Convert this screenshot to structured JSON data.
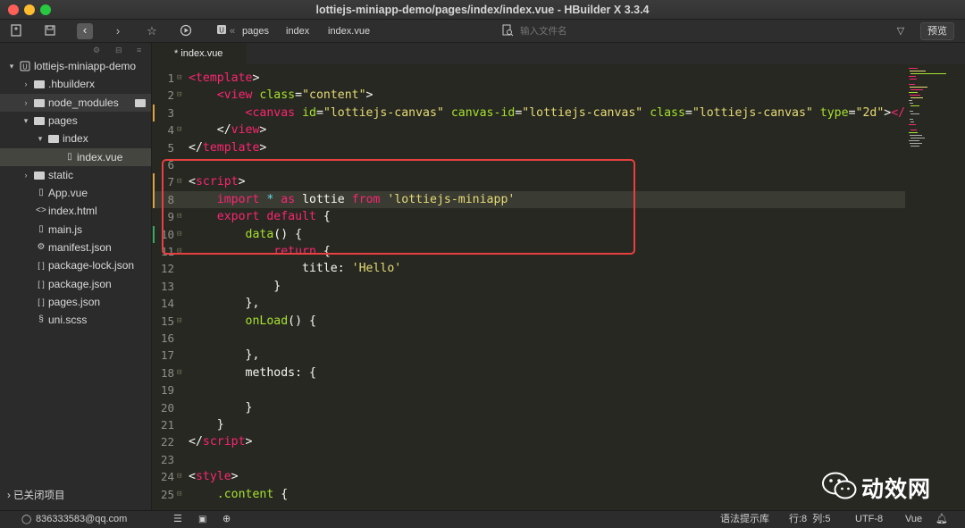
{
  "window": {
    "title": "lottiejs-miniapp-demo/pages/index/index.vue - HBuilder X 3.3.4"
  },
  "toolbar": {
    "breadcrumb": [
      "pages",
      "index",
      "index.vue"
    ],
    "breadcrumb_prefix": "«",
    "search_placeholder": "输入文件名",
    "preview_label": "预览"
  },
  "sidebar": {
    "items": [
      {
        "label": "lottiejs-miniapp-demo",
        "indent": 0,
        "arrow": "▾",
        "icon": "U"
      },
      {
        "label": ".hbuilderx",
        "indent": 1,
        "arrow": "›",
        "icon": "folder"
      },
      {
        "label": "node_modules",
        "indent": 1,
        "arrow": "›",
        "icon": "folder"
      },
      {
        "label": "pages",
        "indent": 1,
        "arrow": "▾",
        "icon": "folder"
      },
      {
        "label": "index",
        "indent": 2,
        "arrow": "▾",
        "icon": "folder"
      },
      {
        "label": "index.vue",
        "indent": 3,
        "arrow": "",
        "icon": "V"
      },
      {
        "label": "static",
        "indent": 1,
        "arrow": "›",
        "icon": "folder"
      },
      {
        "label": "App.vue",
        "indent": 1,
        "arrow": "",
        "icon": "V"
      },
      {
        "label": "index.html",
        "indent": 1,
        "arrow": "",
        "icon": "<>"
      },
      {
        "label": "main.js",
        "indent": 1,
        "arrow": "",
        "icon": "JS"
      },
      {
        "label": "manifest.json",
        "indent": 1,
        "arrow": "",
        "icon": "⚙"
      },
      {
        "label": "package-lock.json",
        "indent": 1,
        "arrow": "",
        "icon": "[ ]"
      },
      {
        "label": "package.json",
        "indent": 1,
        "arrow": "",
        "icon": "[ ]"
      },
      {
        "label": "pages.json",
        "indent": 1,
        "arrow": "",
        "icon": "[ ]"
      },
      {
        "label": "uni.scss",
        "indent": 1,
        "arrow": "",
        "icon": "S"
      }
    ],
    "closed_projects": "已关闭项目"
  },
  "tab": {
    "label": "* index.vue"
  },
  "editor": {
    "lines": [
      {
        "n": "1",
        "fold": "⊟",
        "tokens": [
          [
            "tag",
            "<template"
          ],
          [
            "pl",
            ">"
          ]
        ]
      },
      {
        "n": "2",
        "fold": "⊟",
        "tokens": [
          [
            "pl",
            "    "
          ],
          [
            "tag",
            "<view"
          ],
          [
            "pl",
            " "
          ],
          [
            "attr",
            "class"
          ],
          [
            "pl",
            "="
          ],
          [
            "str",
            "\"content\""
          ],
          [
            "pl",
            ">"
          ]
        ]
      },
      {
        "n": "3",
        "fold": "",
        "tokens": [
          [
            "pl",
            "        "
          ],
          [
            "tag",
            "<canvas"
          ],
          [
            "pl",
            " "
          ],
          [
            "attr",
            "id"
          ],
          [
            "pl",
            "="
          ],
          [
            "str",
            "\"lottiejs-canvas\""
          ],
          [
            "pl",
            " "
          ],
          [
            "attr",
            "canvas-id"
          ],
          [
            "pl",
            "="
          ],
          [
            "str",
            "\"lottiejs-canvas\""
          ],
          [
            "pl",
            " "
          ],
          [
            "attr",
            "class"
          ],
          [
            "pl",
            "="
          ],
          [
            "str",
            "\"lottiejs-canvas\""
          ],
          [
            "pl",
            " "
          ],
          [
            "attr",
            "type"
          ],
          [
            "pl",
            "="
          ],
          [
            "str",
            "\"2d\""
          ],
          [
            "pl",
            ">"
          ],
          [
            "tag",
            "</canvas>"
          ]
        ]
      },
      {
        "n": "4",
        "fold": "⊟",
        "tokens": [
          [
            "pl",
            "    </"
          ],
          [
            "tag",
            "view"
          ],
          [
            "pl",
            ">"
          ]
        ]
      },
      {
        "n": "5",
        "fold": "",
        "tokens": [
          [
            "pl",
            "</"
          ],
          [
            "tag",
            "template"
          ],
          [
            "pl",
            ">"
          ]
        ]
      },
      {
        "n": "6",
        "fold": "",
        "tokens": []
      },
      {
        "n": "7",
        "fold": "⊟",
        "tokens": [
          [
            "pl",
            "<"
          ],
          [
            "tag",
            "script"
          ],
          [
            "pl",
            ">"
          ]
        ]
      },
      {
        "n": "8",
        "fold": "",
        "tokens": [
          [
            "pl",
            "    "
          ],
          [
            "kw",
            "import"
          ],
          [
            "pl",
            " "
          ],
          [
            "op",
            "*"
          ],
          [
            "pl",
            " "
          ],
          [
            "kw",
            "as"
          ],
          [
            "pl",
            " lottie "
          ],
          [
            "kw",
            "from"
          ],
          [
            "pl",
            " "
          ],
          [
            "str",
            "'lottiejs-miniapp'"
          ]
        ]
      },
      {
        "n": "9",
        "fold": "⊟",
        "tokens": [
          [
            "pl",
            "    "
          ],
          [
            "kw",
            "export"
          ],
          [
            "pl",
            " "
          ],
          [
            "kw",
            "default"
          ],
          [
            "pl",
            " {"
          ]
        ]
      },
      {
        "n": "10",
        "fold": "⊟",
        "tokens": [
          [
            "pl",
            "        "
          ],
          [
            "fn",
            "data"
          ],
          [
            "pl",
            "() {"
          ]
        ]
      },
      {
        "n": "11",
        "fold": "⊟",
        "tokens": [
          [
            "pl",
            "            "
          ],
          [
            "kw",
            "return"
          ],
          [
            "pl",
            " {"
          ]
        ]
      },
      {
        "n": "12",
        "fold": "",
        "tokens": [
          [
            "pl",
            "                title: "
          ],
          [
            "str",
            "'Hello'"
          ]
        ]
      },
      {
        "n": "13",
        "fold": "",
        "tokens": [
          [
            "pl",
            "            }"
          ]
        ]
      },
      {
        "n": "14",
        "fold": "",
        "tokens": [
          [
            "pl",
            "        },"
          ]
        ]
      },
      {
        "n": "15",
        "fold": "⊟",
        "tokens": [
          [
            "pl",
            "        "
          ],
          [
            "fn",
            "onLoad"
          ],
          [
            "pl",
            "() {"
          ]
        ]
      },
      {
        "n": "16",
        "fold": "",
        "tokens": []
      },
      {
        "n": "17",
        "fold": "",
        "tokens": [
          [
            "pl",
            "        },"
          ]
        ]
      },
      {
        "n": "18",
        "fold": "⊟",
        "tokens": [
          [
            "pl",
            "        methods: {"
          ]
        ]
      },
      {
        "n": "19",
        "fold": "",
        "tokens": []
      },
      {
        "n": "20",
        "fold": "",
        "tokens": [
          [
            "pl",
            "        }"
          ]
        ]
      },
      {
        "n": "21",
        "fold": "",
        "tokens": [
          [
            "pl",
            "    }"
          ]
        ]
      },
      {
        "n": "22",
        "fold": "",
        "tokens": [
          [
            "pl",
            "</"
          ],
          [
            "tag",
            "script"
          ],
          [
            "pl",
            ">"
          ]
        ]
      },
      {
        "n": "23",
        "fold": "",
        "tokens": []
      },
      {
        "n": "24",
        "fold": "⊟",
        "tokens": [
          [
            "pl",
            "<"
          ],
          [
            "tag",
            "style"
          ],
          [
            "pl",
            ">"
          ]
        ]
      },
      {
        "n": "25",
        "fold": "⊟",
        "tokens": [
          [
            "pl",
            "    "
          ],
          [
            "cls",
            ".content"
          ],
          [
            "pl",
            " {"
          ]
        ]
      }
    ],
    "current_line": "8"
  },
  "statusbar": {
    "account": "836333583@qq.com",
    "plugin_market": "语法提示库",
    "position": "行:8  列:5",
    "encoding": "UTF-8",
    "language": "Vue"
  },
  "watermark": {
    "text": "动效网"
  },
  "colors": {
    "highlight_box": "#e8403f",
    "editor_bg": "#272822",
    "tag": "#f92672",
    "attr": "#a6e22e",
    "string": "#e6db74"
  }
}
